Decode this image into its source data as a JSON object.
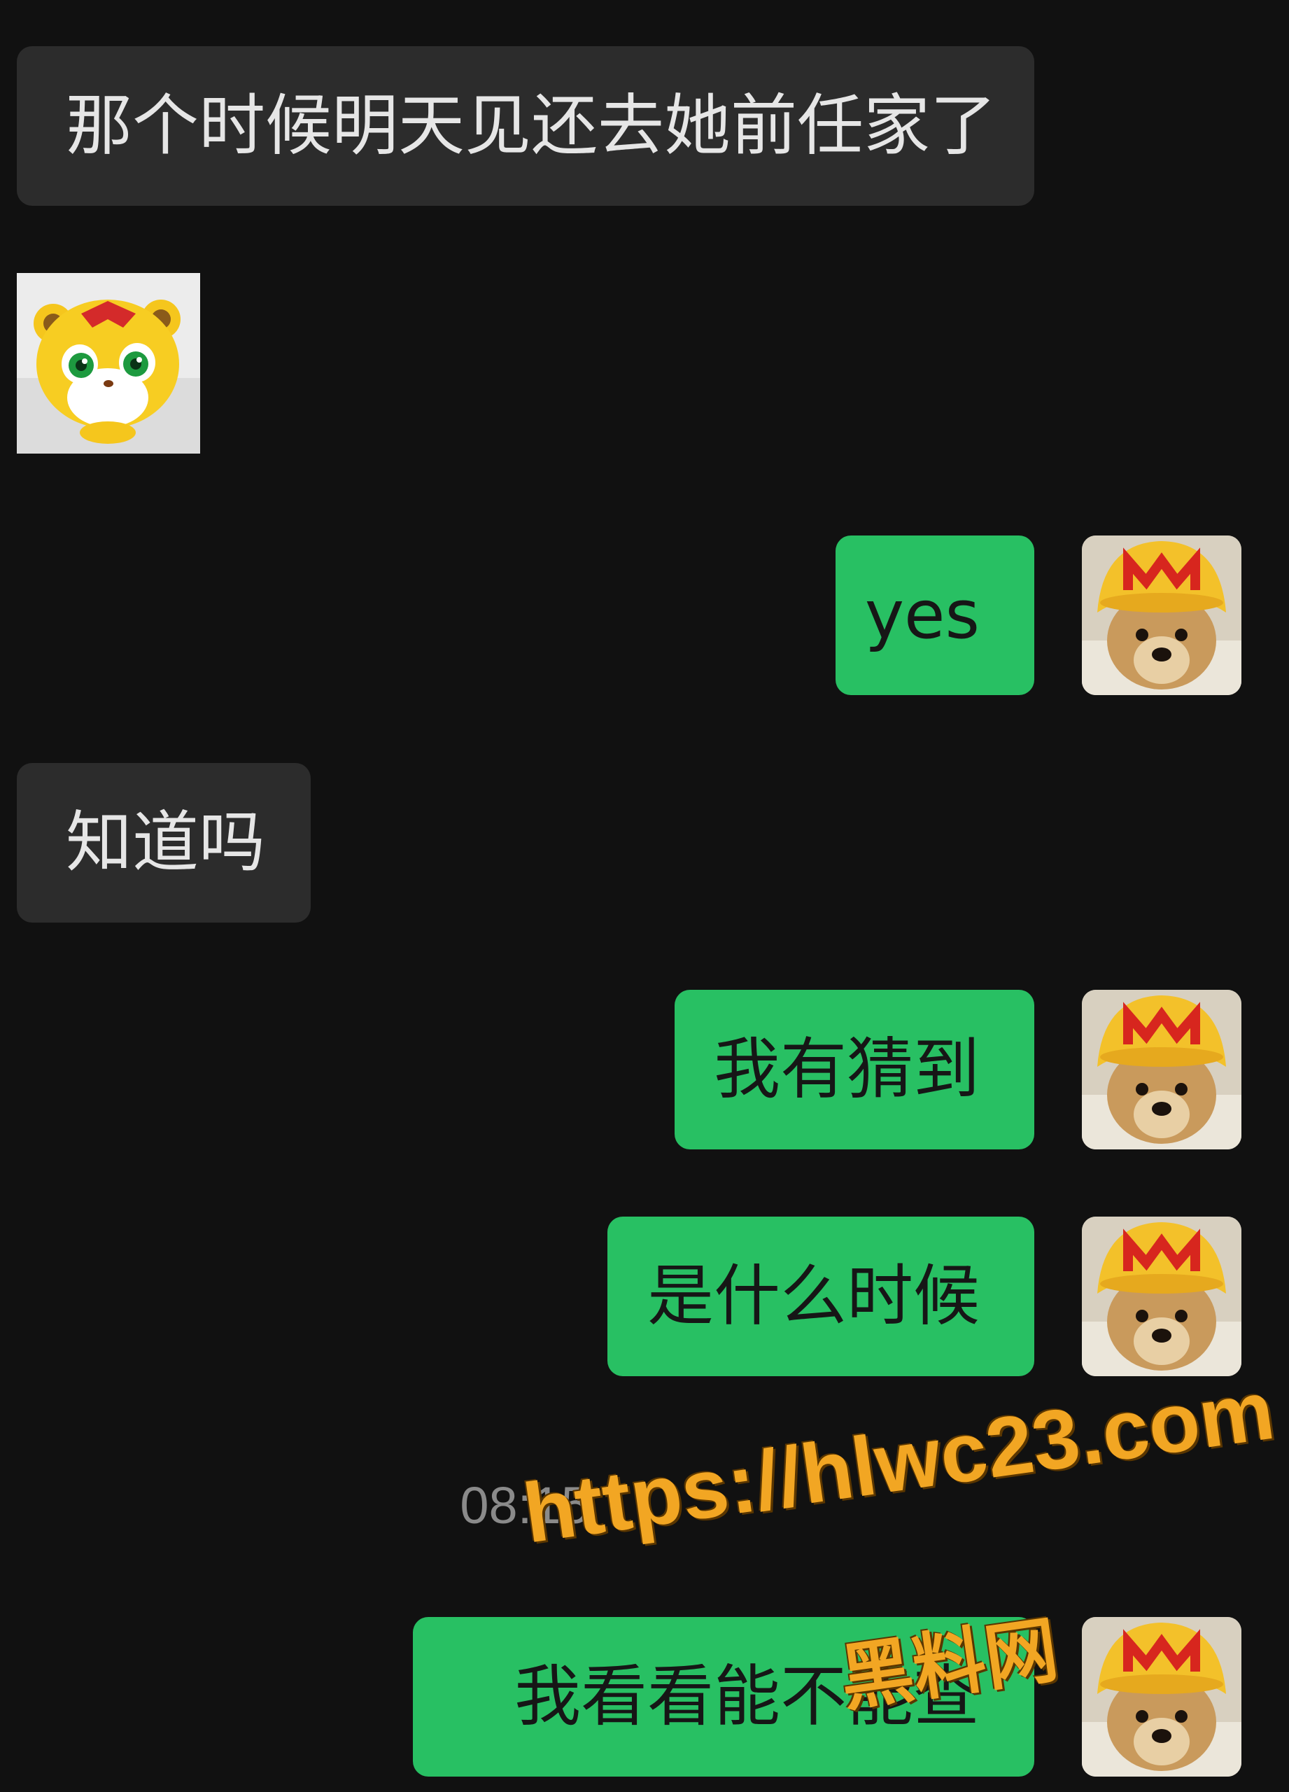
{
  "messages": [
    {
      "side": "in",
      "type": "text",
      "text": "那个时候明天见还去她前任家了"
    },
    {
      "side": "in",
      "type": "sticker",
      "sticker": "yellow-tiger-cartoon"
    },
    {
      "side": "out",
      "type": "text",
      "text": "yes",
      "avatar": "dog-mcdonalds-hat"
    },
    {
      "side": "in",
      "type": "text",
      "text": "知道吗"
    },
    {
      "side": "out",
      "type": "text",
      "text": "我有猜到",
      "avatar": "dog-mcdonalds-hat"
    },
    {
      "side": "out",
      "type": "text",
      "text": "是什么时候",
      "avatar": "dog-mcdonalds-hat"
    },
    {
      "side": "out",
      "type": "text",
      "text": "我看看能不能查",
      "avatar": "dog-mcdonalds-hat"
    }
  ],
  "timestamp": "08:15",
  "watermark": {
    "url": "https://hlwc23.com",
    "brand": "黑料网"
  },
  "colors": {
    "background": "#111111",
    "incoming_bubble": "#2c2c2c",
    "outgoing_bubble": "#28c063",
    "timestamp": "#8a8a8a",
    "watermark": "#f2a623"
  }
}
